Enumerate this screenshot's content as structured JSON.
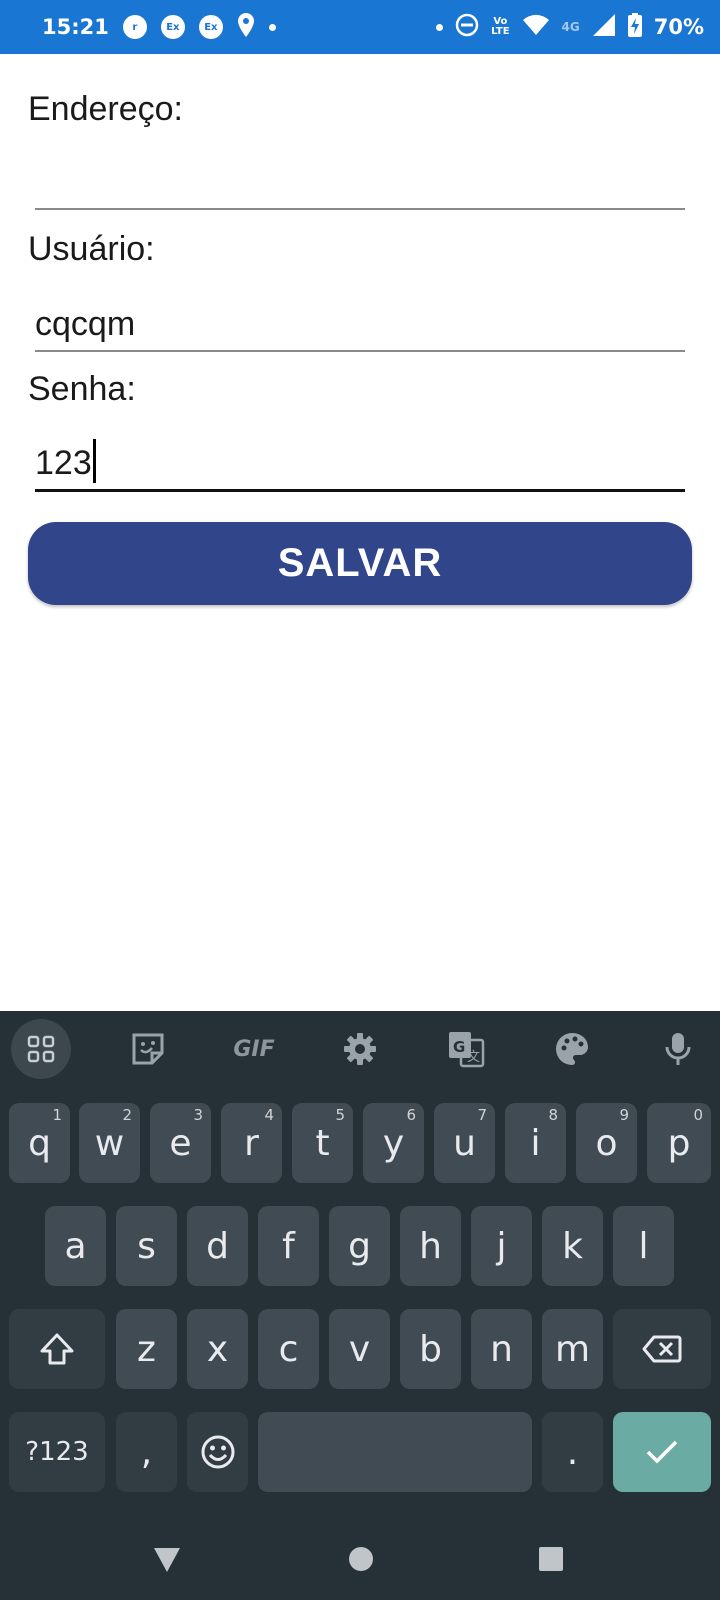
{
  "status_bar": {
    "time": "15:21",
    "icons_left": [
      "notification-r-icon",
      "exchange-icon",
      "exchange-icon",
      "location-icon",
      "dot-icon"
    ],
    "icons_right": [
      "dot-icon",
      "do-not-disturb-icon",
      "volte-icon",
      "wifi-icon",
      "signal-icon",
      "battery-charging-icon"
    ],
    "ex1": "Ex",
    "ex2": "Ex",
    "vo_lte_top": "Vo",
    "vo_lte_bottom": "LTE",
    "network": "4G",
    "battery": "70%"
  },
  "form": {
    "address_label": "Endereço:",
    "address_value": "",
    "user_label": "Usuário:",
    "user_value": "cqcqm",
    "password_label": "Senha:",
    "password_value": "123",
    "save_label": "SALVAR"
  },
  "keyboard": {
    "toolbar": [
      "apps-grid-icon",
      "sticker-icon",
      "GIF",
      "settings-icon",
      "translate-icon",
      "palette-icon",
      "microphone-icon"
    ],
    "gif_label": "GIF",
    "row1": [
      {
        "k": "q",
        "hint": "1"
      },
      {
        "k": "w",
        "hint": "2"
      },
      {
        "k": "e",
        "hint": "3"
      },
      {
        "k": "r",
        "hint": "4"
      },
      {
        "k": "t",
        "hint": "5"
      },
      {
        "k": "y",
        "hint": "6"
      },
      {
        "k": "u",
        "hint": "7"
      },
      {
        "k": "i",
        "hint": "8"
      },
      {
        "k": "o",
        "hint": "9"
      },
      {
        "k": "p",
        "hint": "0"
      }
    ],
    "row2": [
      "a",
      "s",
      "d",
      "f",
      "g",
      "h",
      "j",
      "k",
      "l"
    ],
    "row3": [
      "z",
      "x",
      "c",
      "v",
      "b",
      "n",
      "m"
    ],
    "symbols_label": "?123",
    "comma_label": ",",
    "period_label": ".",
    "accent_color": "#6aaba3"
  },
  "colors": {
    "status_bar": "#1976d2",
    "button": "#30458a",
    "keyboard_bg": "#263037"
  }
}
